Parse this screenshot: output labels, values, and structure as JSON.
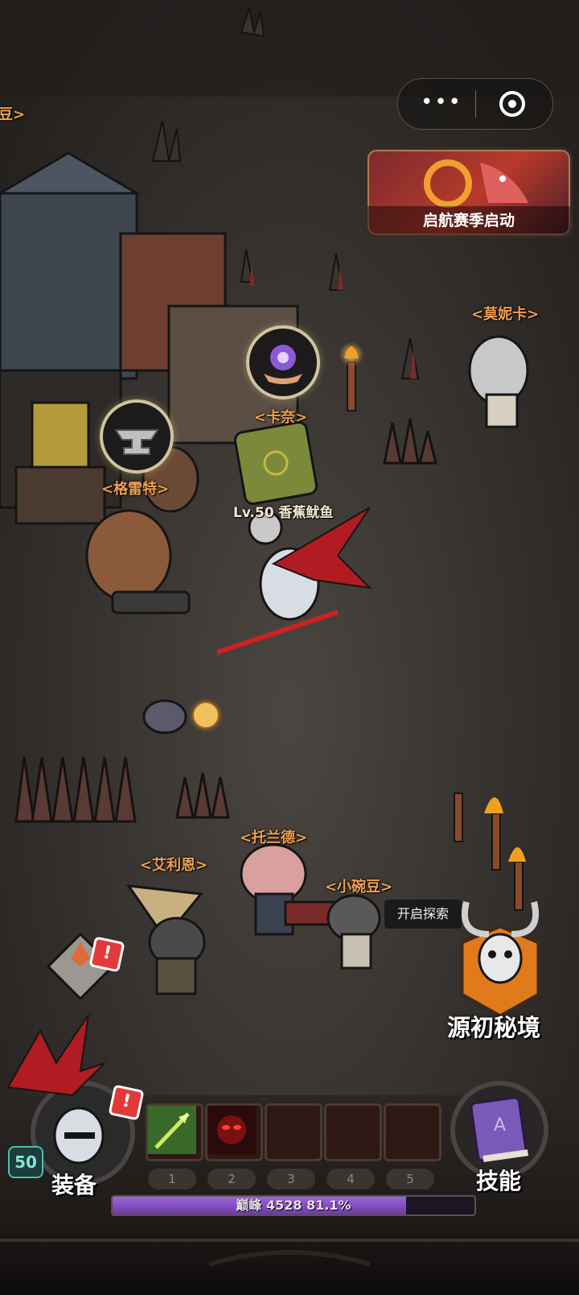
{
  "capsule": {
    "more_icon": "more-dots-icon",
    "close_icon": "target-circle-icon"
  },
  "season_banner": {
    "label": "启航赛季启动"
  },
  "npcs": {
    "top_left_partial": "豆>",
    "monica": "<莫妮卡>",
    "kana": "<卡奈>",
    "gret": "<格雷特>",
    "toland": "<托兰德>",
    "alien": "<艾利恩>",
    "pea": "<小碗豆>"
  },
  "player": {
    "name": "Lv.50 香蕉鱿鱼"
  },
  "explore_tooltip": "开启探索",
  "secret_realm": {
    "label": "源初秘境",
    "icon": "horned-skull-shield-icon"
  },
  "equip": {
    "label": "装备",
    "level": "50",
    "badge": "!"
  },
  "map_badge": "!",
  "equip_badge": "!",
  "skills": {
    "label": "技能",
    "icon": "spellbook-icon"
  },
  "skill_slots": [
    {
      "num": "1",
      "icon": "green-arrow-icon"
    },
    {
      "num": "2",
      "icon": "red-eye-demon-icon"
    },
    {
      "num": "3",
      "icon": ""
    },
    {
      "num": "4",
      "icon": ""
    },
    {
      "num": "5",
      "icon": ""
    }
  ],
  "xp": {
    "label": "巅峰 4528",
    "percent_text": "81.1%",
    "fraction": 0.811
  },
  "colors": {
    "npc_name": "#f0a050",
    "xp_fill": "#9b64d6",
    "badge": "#e23a3a"
  }
}
